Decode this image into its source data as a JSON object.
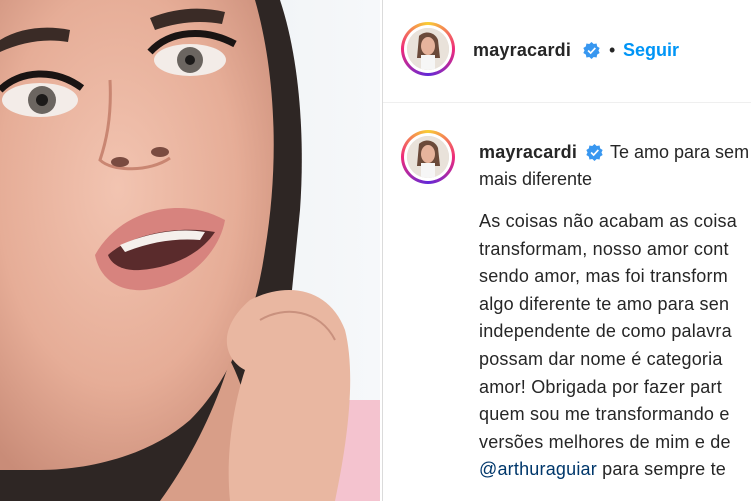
{
  "header": {
    "username": "mayracardi",
    "separator": "•",
    "follow_label": "Seguir"
  },
  "comment": {
    "username": "mayracardi",
    "caption_start": "Te amo para sem",
    "caption_cont": "mais diferente",
    "body_lines": [
      "As coisas não acabam as coisa",
      "transformam, nosso amor cont",
      "sendo amor, mas foi transform",
      "algo diferente te amo para sen",
      "independente de como palavra",
      "possam dar nome é categoria",
      "amor! Obrigada por fazer part",
      "quem sou me transformando e",
      "versões melhores de mim e de"
    ],
    "mention": "@arthuraguiar",
    "last_line_rest": " para sempre te"
  },
  "icons": {
    "verified": "verified-badge-icon",
    "accent": "#0095f6",
    "mention_color": "#00376b"
  }
}
